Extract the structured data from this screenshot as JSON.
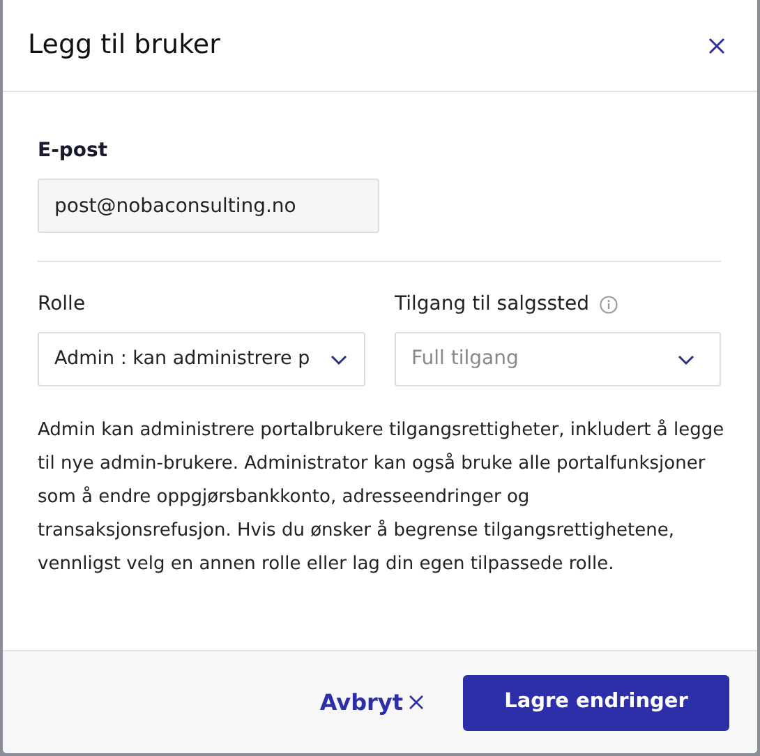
{
  "dialog": {
    "title": "Legg til bruker"
  },
  "email": {
    "label": "E-post",
    "value": "post@nobaconsulting.no"
  },
  "role": {
    "label": "Rolle",
    "value": "Admin : kan administrere p"
  },
  "access": {
    "label": "Tilgang til salgssted",
    "placeholder": "Full tilgang"
  },
  "description": "Admin kan administrere portalbrukere tilgangsrettigheter, inkludert å legge til nye admin-brukere. Administrator kan også bruke alle portalfunksjoner som å endre oppgjørsbankkonto, adresseendringer og transaksjonsrefusjon. Hvis du ønsker å begrense tilgangsrettighetene, vennligst velg en annen rolle eller lag din egen tilpassede rolle.",
  "buttons": [
    {
      "kind": "cancel",
      "label": "Avbryt"
    },
    {
      "kind": "primary",
      "label": "Lagre endringer"
    }
  ]
}
